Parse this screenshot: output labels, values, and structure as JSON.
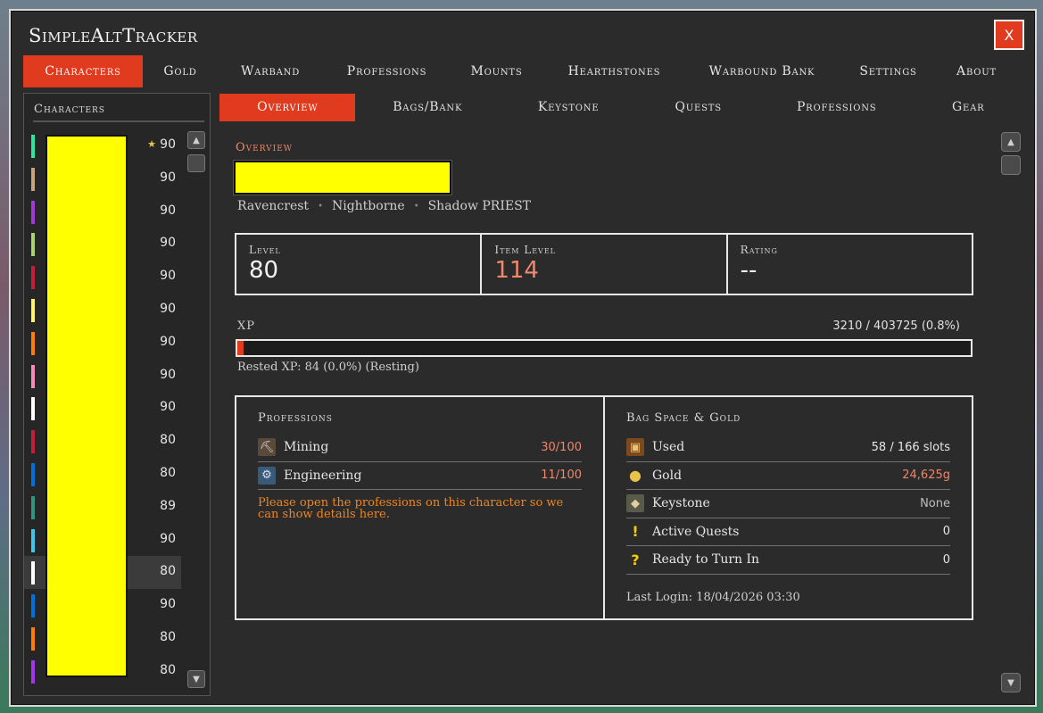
{
  "app": {
    "title": "SimpleAltTracker",
    "close_label": "X"
  },
  "main_tabs": [
    {
      "label": "Characters",
      "active": true
    },
    {
      "label": "Gold",
      "active": false
    },
    {
      "label": "Warband",
      "active": false
    },
    {
      "label": "Professions",
      "active": false
    },
    {
      "label": "Mounts",
      "active": false
    },
    {
      "label": "Hearthstones",
      "active": false
    },
    {
      "label": "Warbound Bank",
      "active": false
    },
    {
      "label": "Settings",
      "active": false
    },
    {
      "label": "About",
      "active": false
    }
  ],
  "sidebar": {
    "title": "Characters",
    "characters": [
      {
        "level": "90",
        "color": "#2ee6a0",
        "favorite": true
      },
      {
        "level": "90",
        "color": "#c9a27e"
      },
      {
        "level": "90",
        "color": "#a03ad6"
      },
      {
        "level": "90",
        "color": "#a9d271"
      },
      {
        "level": "90",
        "color": "#c41e3a"
      },
      {
        "level": "90",
        "color": "#fff468"
      },
      {
        "level": "90",
        "color": "#ff7c0a"
      },
      {
        "level": "90",
        "color": "#f48cba"
      },
      {
        "level": "90",
        "color": "#ffffff"
      },
      {
        "level": "80",
        "color": "#c41e3a"
      },
      {
        "level": "80",
        "color": "#0070dd"
      },
      {
        "level": "89",
        "color": "#33937f"
      },
      {
        "level": "90",
        "color": "#3fc7eb"
      },
      {
        "level": "80",
        "color": "#ffffff",
        "selected": true
      },
      {
        "level": "90",
        "color": "#0070dd"
      },
      {
        "level": "80",
        "color": "#ff7c0a"
      },
      {
        "level": "80",
        "color": "#a335ee"
      }
    ]
  },
  "sub_tabs": [
    {
      "label": "Overview",
      "active": true
    },
    {
      "label": "Bags/Bank",
      "active": false
    },
    {
      "label": "Keystone",
      "active": false
    },
    {
      "label": "Quests",
      "active": false
    },
    {
      "label": "Professions",
      "active": false
    },
    {
      "label": "Gear",
      "active": false
    }
  ],
  "overview": {
    "section_label": "Overview",
    "realm": "Ravencrest",
    "race": "Nightborne",
    "spec_class": "Shadow PRIEST",
    "stats": {
      "level_label": "Level",
      "level_value": "80",
      "ilvl_label": "Item Level",
      "ilvl_value": "114",
      "rating_label": "Rating",
      "rating_value": "--"
    },
    "xp": {
      "label": "XP",
      "value": "3210 / 403725 (0.8%)",
      "progress_fraction": 0.008,
      "rested": "Rested XP: 84 (0.0%)  (Resting)"
    },
    "professions": {
      "title": "Professions",
      "items": [
        {
          "name": "Mining",
          "value": "30/100",
          "icon": "pickaxe-icon"
        },
        {
          "name": "Engineering",
          "value": "11/100",
          "icon": "gear-icon"
        }
      ],
      "notice": "Please open the professions on this character so we can show details here."
    },
    "bags": {
      "title": "Bag Space & Gold",
      "used_label": "Used",
      "used_value": "58 / 166 slots",
      "gold_label": "Gold",
      "gold_value": "24,625g",
      "keystone_label": "Keystone",
      "keystone_value": "None",
      "active_quests_label": "Active Quests",
      "active_quests_value": "0",
      "turnin_label": "Ready to Turn In",
      "turnin_value": "0",
      "last_login": "Last Login: 18/04/2026 03:30"
    }
  }
}
